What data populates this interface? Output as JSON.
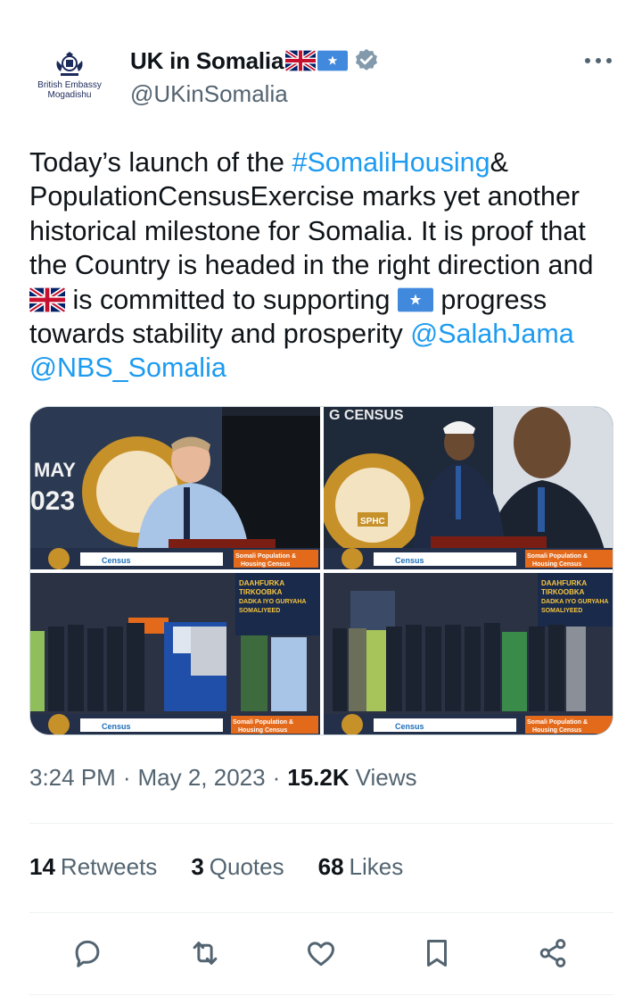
{
  "account": {
    "name": "UK in Somalia",
    "handle": "@UKinSomalia",
    "avatar_line1": "British Embassy",
    "avatar_line2": "Mogadishu"
  },
  "tweet": {
    "text_part1": "Today’s launch of the ",
    "hashtag": "#SomaliHousing",
    "text_part2": "& PopulationCensusExercise marks yet another historical milestone for Somalia. It is proof that the Country is headed in the right direction and ",
    "text_part3": " is committed to supporting ",
    "text_part4": " progress towards stability and prosperity ",
    "mention1": "@SalahJama",
    "mention2": "@NBS_Somalia"
  },
  "media": {
    "photo1_text_a": "MAY",
    "photo1_text_b": "023",
    "photo2_text": "G CENSUS",
    "photo2_logo": "SPHC",
    "banner_text_a": "Somali Population &",
    "banner_text_b": "Housing Census",
    "census_logo": "Census",
    "photo3_screen_a": "DAAHFURKA",
    "photo3_screen_b": "TIRKOOBKA",
    "photo3_screen_c": "DADKA IYO GURYAHA",
    "photo3_screen_d": "SOMALIYEED"
  },
  "meta": {
    "time": "3:24 PM",
    "date": "May 2, 2023",
    "views_count": "15.2K",
    "views_label": "Views"
  },
  "stats": {
    "retweets_count": "14",
    "retweets_label": "Retweets",
    "quotes_count": "3",
    "quotes_label": "Quotes",
    "likes_count": "68",
    "likes_label": "Likes"
  },
  "colors": {
    "link": "#1d9bf0",
    "secondary": "#536471",
    "primary": "#0f1419",
    "border": "#cfd9de"
  },
  "icons": [
    "more-icon",
    "verified-badge-icon",
    "uk-flag-icon",
    "somalia-flag-icon",
    "reply-icon",
    "retweet-icon",
    "like-icon",
    "bookmark-icon",
    "share-icon"
  ]
}
